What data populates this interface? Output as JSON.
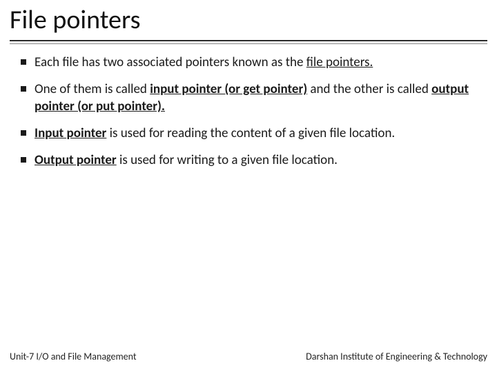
{
  "title": "File pointers",
  "bullets": [
    {
      "pre": "Each file has two associated pointers known as the ",
      "em1": "file pointers.",
      "mid": "",
      "em2": "",
      "post": ""
    },
    {
      "pre": "One of them is called ",
      "em1": "input pointer (or get pointer)",
      "mid": " and the other is called ",
      "em2": "output pointer (or put pointer).",
      "post": ""
    },
    {
      "pre": "",
      "em1": "Input pointer",
      "mid": " is used for reading the content of a given file location.",
      "em2": "",
      "post": ""
    },
    {
      "pre": "",
      "em1": "Output pointer",
      "mid": " is used for writing to a given file location.",
      "em2": "",
      "post": ""
    }
  ],
  "footer": {
    "left": "Unit-7 I/O and File Management",
    "right": "Darshan Institute of Engineering & Technology"
  }
}
